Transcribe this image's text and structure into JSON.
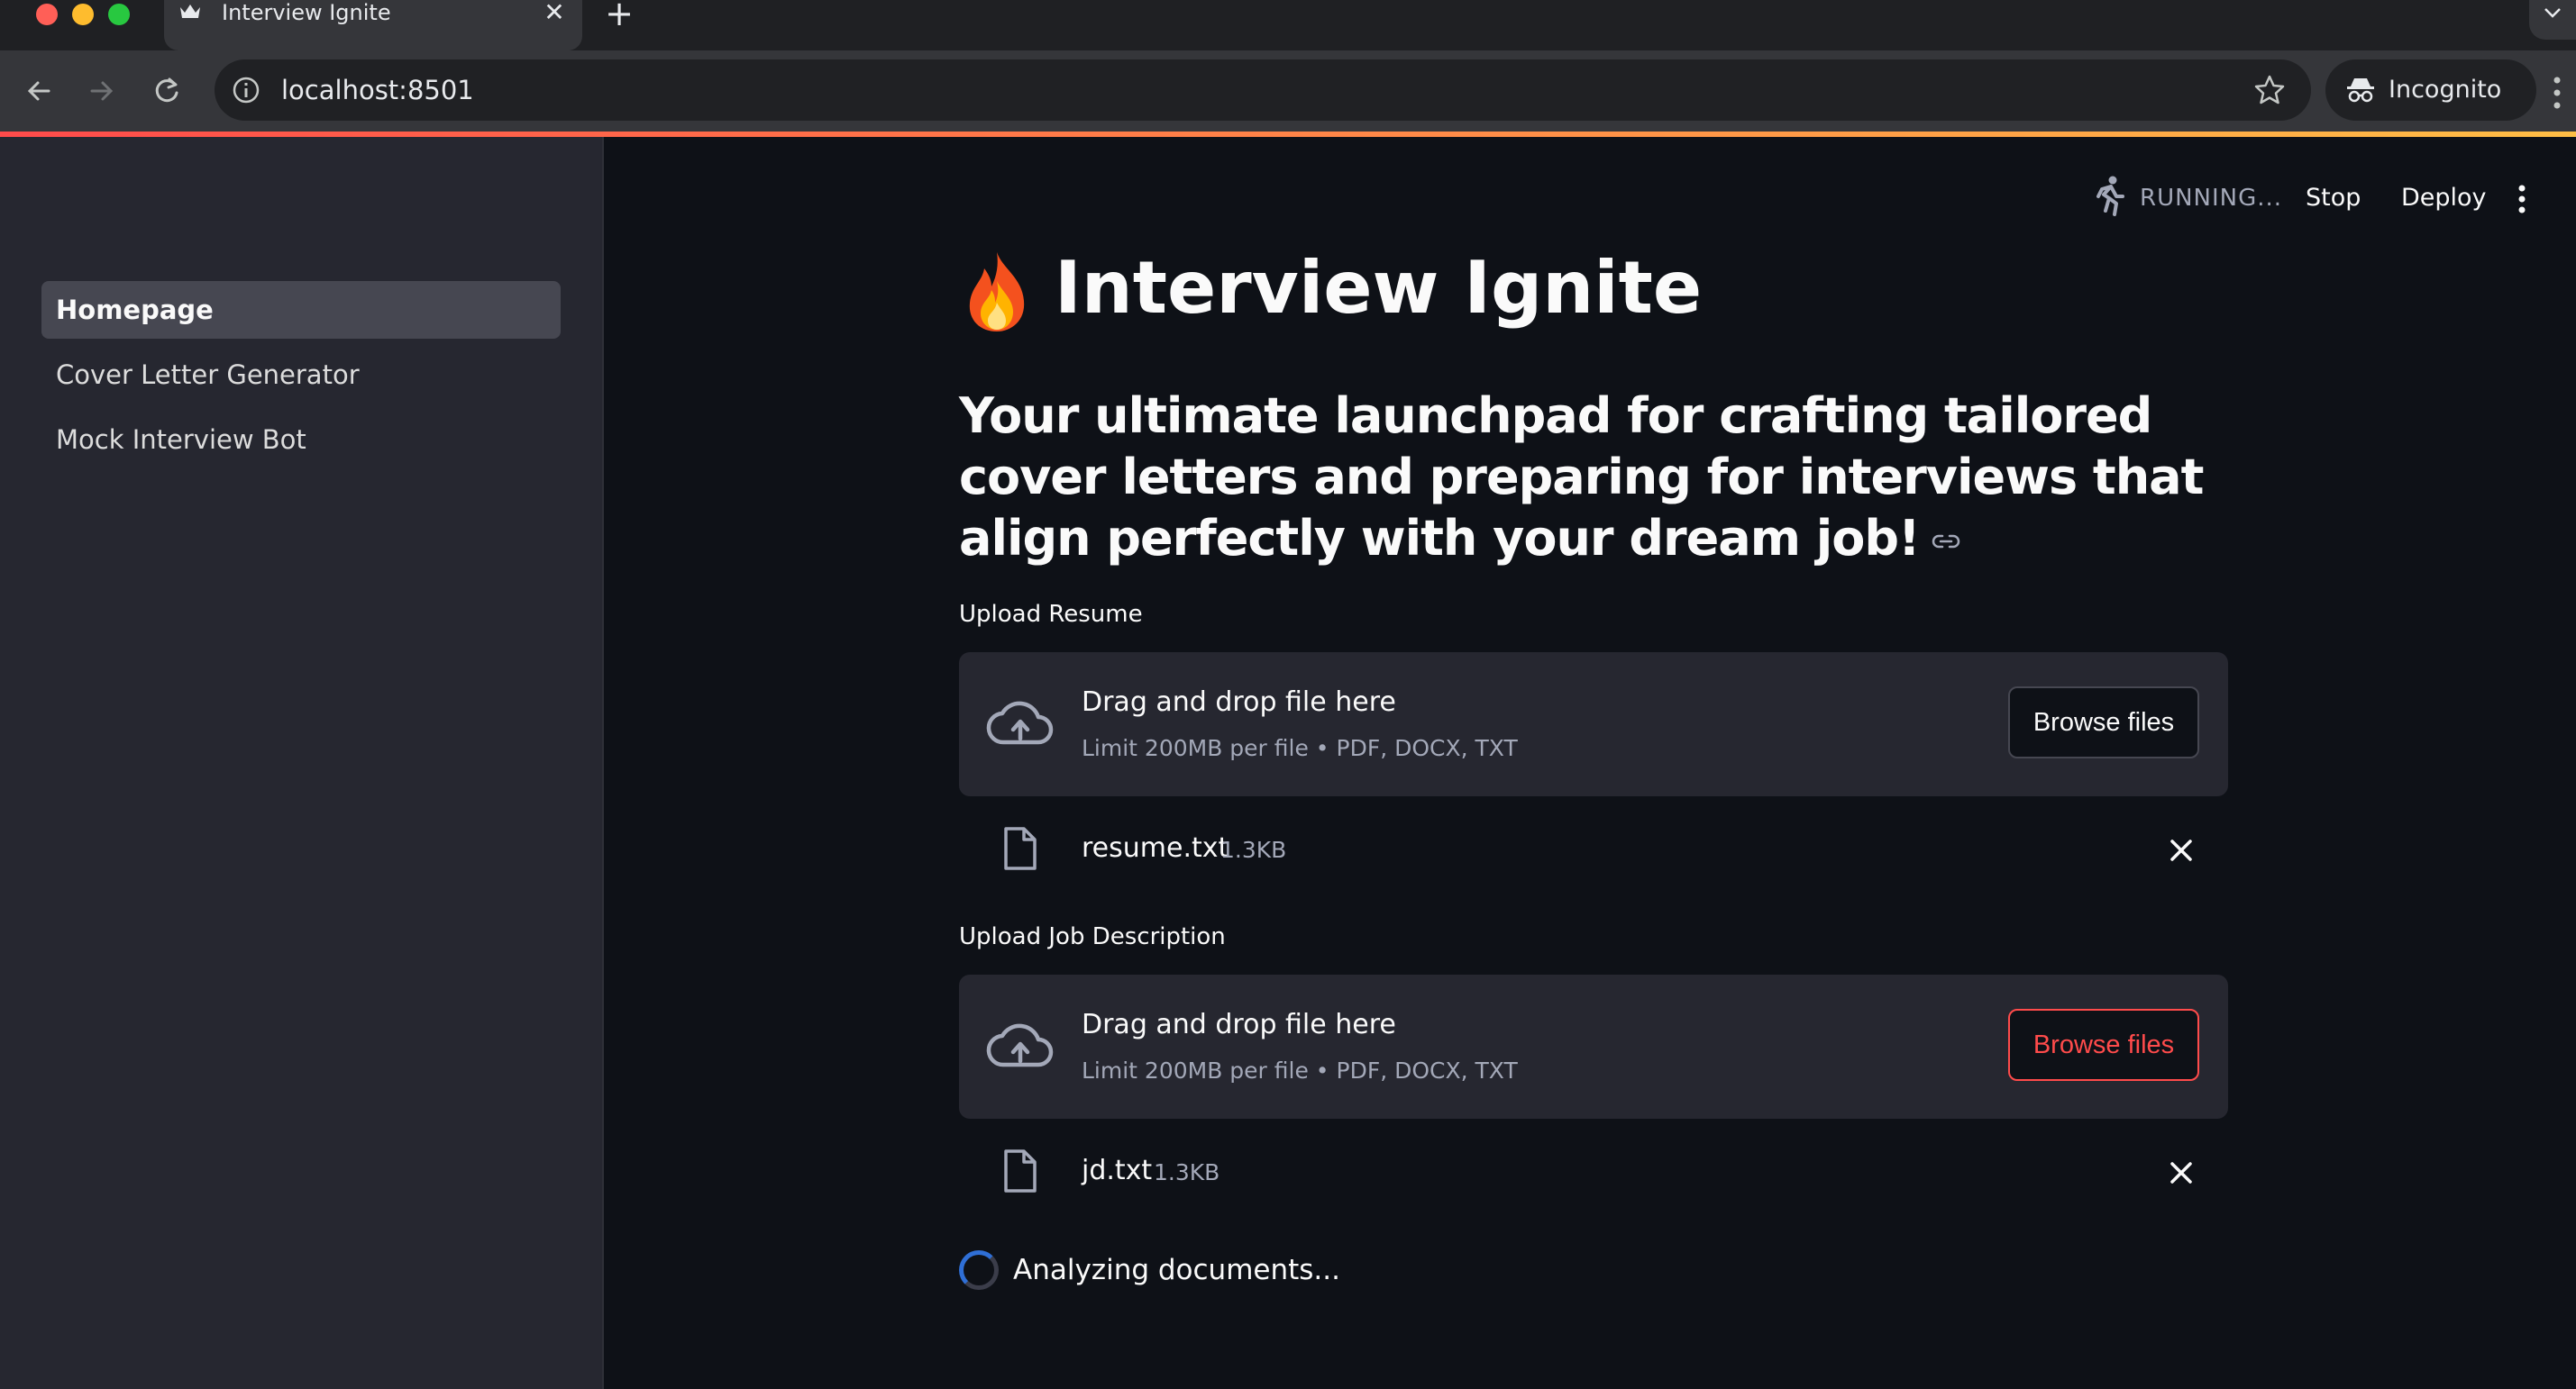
{
  "browser": {
    "tab_title": "Interview Ignite",
    "tab_close": "✕",
    "new_tab": "+",
    "url": "localhost:8501",
    "incognito_label": "Incognito"
  },
  "sidebar": {
    "items": [
      {
        "label": "Homepage",
        "active": true
      },
      {
        "label": "Cover Letter Generator",
        "active": false
      },
      {
        "label": "Mock Interview Bot",
        "active": false
      }
    ]
  },
  "header": {
    "status": "RUNNING...",
    "stop_label": "Stop",
    "deploy_label": "Deploy"
  },
  "main": {
    "title": "Interview Ignite",
    "title_icon": "fire-icon",
    "subheading": "Your ultimate launchpad for crafting tailored cover letters and preparing for interviews that align perfectly with your dream job!",
    "uploads": [
      {
        "label": "Upload Resume",
        "drop_text": "Drag and drop file here",
        "limit_text": "Limit 200MB per file • PDF, DOCX, TXT",
        "browse_label": "Browse files",
        "file": {
          "name": "resume.txt",
          "size": "1.3KB"
        }
      },
      {
        "label": "Upload Job Description",
        "drop_text": "Drag and drop file here",
        "limit_text": "Limit 200MB per file • PDF, DOCX, TXT",
        "browse_label": "Browse files",
        "file": {
          "name": "jd.txt",
          "size": "1.3KB"
        }
      }
    ],
    "spinner_text": "Analyzing documents..."
  },
  "colors": {
    "accent": "#ff4b4b",
    "background": "#0e1117",
    "sidebar": "#262730",
    "spinner": "#2f6fd6"
  }
}
